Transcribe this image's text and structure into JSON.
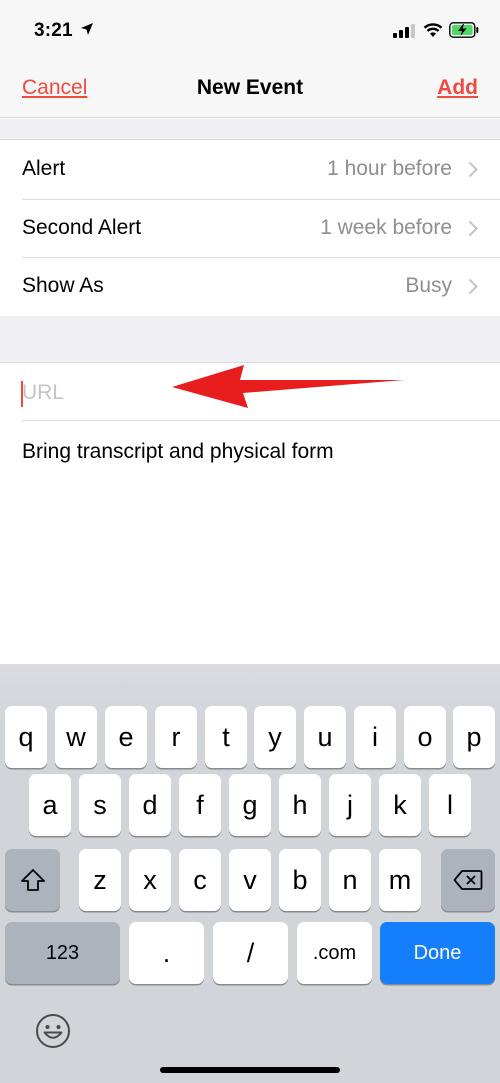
{
  "status_bar": {
    "time": "3:21"
  },
  "nav": {
    "cancel": "Cancel",
    "title": "New Event",
    "add": "Add"
  },
  "settings": [
    {
      "label": "Alert",
      "value": "1 hour before"
    },
    {
      "label": "Second Alert",
      "value": "1 week before"
    },
    {
      "label": "Show As",
      "value": "Busy"
    }
  ],
  "url": {
    "placeholder": "URL",
    "value": ""
  },
  "notes": {
    "text": "Bring transcript and physical form"
  },
  "annotation": {
    "arrow_color": "#e81e1e"
  },
  "keyboard": {
    "row1": [
      "q",
      "w",
      "e",
      "r",
      "t",
      "y",
      "u",
      "i",
      "o",
      "p"
    ],
    "row2": [
      "a",
      "s",
      "d",
      "f",
      "g",
      "h",
      "j",
      "k",
      "l"
    ],
    "row3": [
      "z",
      "x",
      "c",
      "v",
      "b",
      "n",
      "m"
    ],
    "numbers_key": "123",
    "period_key": ".",
    "slash_key": "/",
    "dotcom_key": ".com",
    "done_key": "Done"
  },
  "colors": {
    "accent": "#f04a3f",
    "done_blue": "#157efb"
  }
}
